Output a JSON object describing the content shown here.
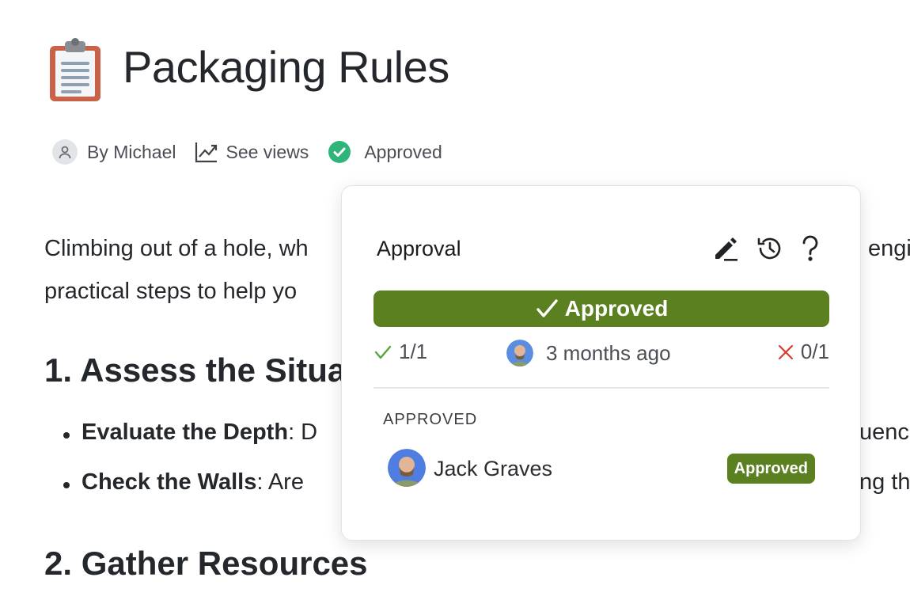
{
  "page": {
    "title": "Packaging Rules",
    "icon": "clipboard-icon"
  },
  "meta": {
    "author": "By Michael",
    "views": "See views",
    "status": "Approved"
  },
  "content": {
    "para_line1": "Climbing out of a hole, wh",
    "para_line1_right": "engi",
    "para_line2": "practical steps to help yo",
    "heading1": "1. Assess the Situa",
    "bullet1_bold": "Evaluate the Depth",
    "bullet1_text": ": D",
    "bullet1_right": "uenc",
    "bullet2_bold": "Check the Walls",
    "bullet2_text": ": Are",
    "bullet2_right": "ng th",
    "heading2": "2. Gather Resources"
  },
  "approval_popover": {
    "title": "Approval",
    "icons": [
      "edit-icon",
      "history-icon",
      "help-icon"
    ],
    "status_button": "Approved",
    "approved_count": "1/1",
    "time_ago": "3 months ago",
    "rejected_count": "0/1",
    "section_label": "APPROVED",
    "approvers": [
      {
        "name": "Jack Graves",
        "badge": "Approved"
      }
    ]
  },
  "colors": {
    "approved_green": "#5a8020",
    "check_green": "#2fb57a",
    "reject_red": "#d93a2b"
  }
}
